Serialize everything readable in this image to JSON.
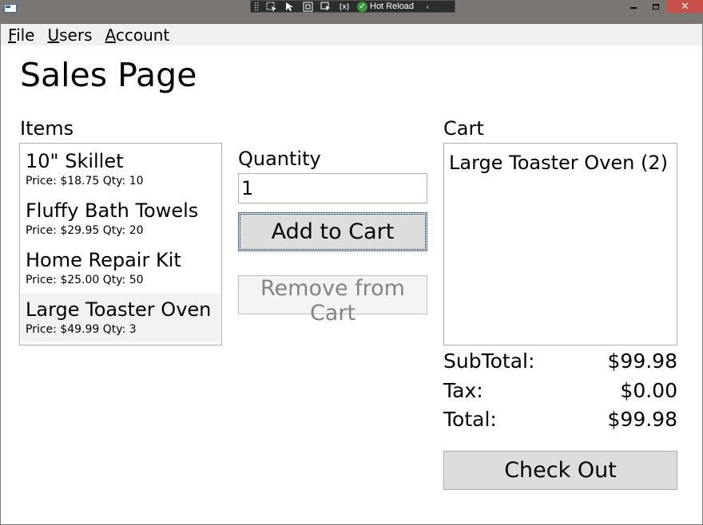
{
  "devbar": {
    "hot_reload_label": "Hot Reload"
  },
  "menu": {
    "file": "File",
    "file_rest": "ile",
    "users": "Users",
    "users_rest": "sers",
    "account": "Account",
    "account_rest": "ccount"
  },
  "page": {
    "title": "Sales Page"
  },
  "items": {
    "label": "Items",
    "list": [
      {
        "name": "10\" Skillet",
        "meta": "Price: $18.75 Qty: 10"
      },
      {
        "name": "Fluffy Bath Towels",
        "meta": "Price: $29.95 Qty: 20"
      },
      {
        "name": "Home Repair Kit",
        "meta": "Price: $25.00 Qty: 50"
      },
      {
        "name": "Large Toaster Oven",
        "meta": "Price: $49.99 Qty: 3",
        "selected": true
      }
    ]
  },
  "quantity": {
    "label": "Quantity",
    "value": "1"
  },
  "buttons": {
    "add_to_cart": "Add to Cart",
    "remove_from_cart": "Remove from Cart",
    "check_out": "Check Out"
  },
  "cart": {
    "label": "Cart",
    "items": [
      "Large Toaster Oven (2)"
    ],
    "subtotal_label": "SubTotal:",
    "subtotal_value": "$99.98",
    "tax_label": "Tax:",
    "tax_value": "$0.00",
    "total_label": "Total:",
    "total_value": "$99.98"
  },
  "colors": {
    "titlebar": "#7a7673",
    "close_button": "#c7504b",
    "hot_reload_check": "#3c9a3c"
  }
}
